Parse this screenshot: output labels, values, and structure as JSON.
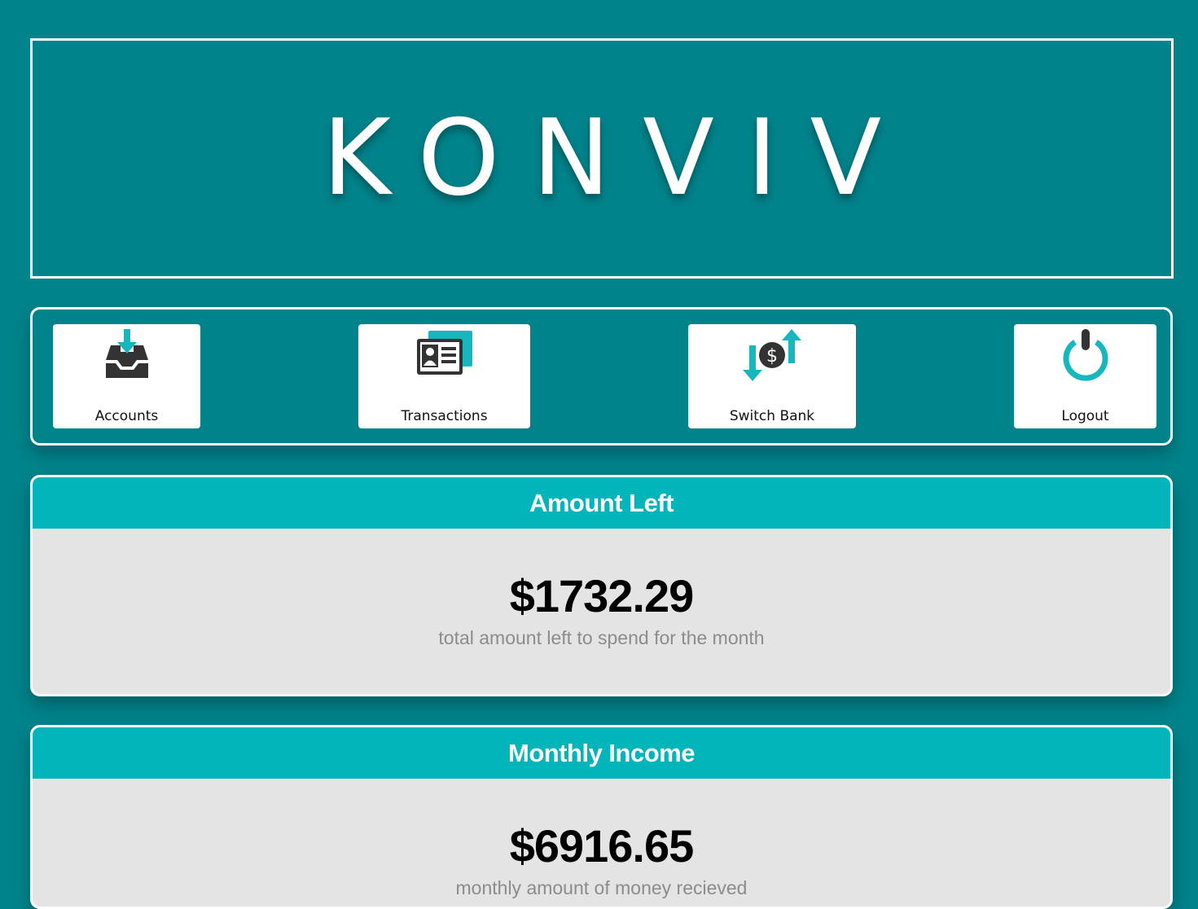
{
  "brand": {
    "title": "KONVIV"
  },
  "nav": {
    "items": [
      {
        "label": "Accounts",
        "icon": "inbox-download-icon"
      },
      {
        "label": "Transactions",
        "icon": "id-card-icon"
      },
      {
        "label": "Switch Bank",
        "icon": "exchange-dollar-icon"
      },
      {
        "label": "Logout",
        "icon": "power-icon"
      }
    ]
  },
  "panels": [
    {
      "title": "Amount Left",
      "amount": "$1732.29",
      "caption": "total amount left to spend for the month"
    },
    {
      "title": "Monthly Income",
      "amount": "$6916.65",
      "caption": "monthly amount of money recieved"
    }
  ],
  "colors": {
    "background": "#01838b",
    "accent": "#01b5bb",
    "panel_body": "#e4e4e4",
    "icon_dark": "#333333"
  }
}
